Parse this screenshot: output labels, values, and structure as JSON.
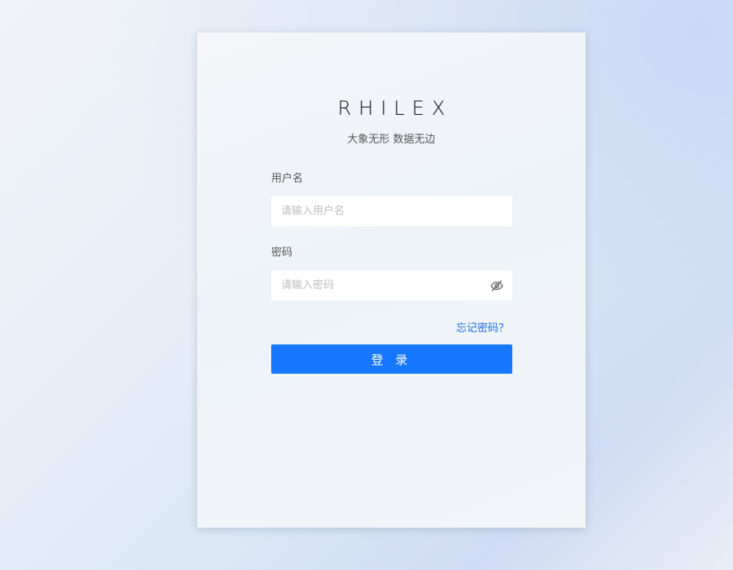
{
  "brand": {
    "logo_text": "RHILEX",
    "tagline": "大象无形 数据无边"
  },
  "form": {
    "username": {
      "label": "用户名",
      "placeholder": "请输入用户名",
      "value": ""
    },
    "password": {
      "label": "密码",
      "placeholder": "请输入密码",
      "value": "",
      "toggle_icon": "eye-invisible-icon"
    },
    "forgot_password_label": "忘记密码？",
    "submit_label": "登 录"
  },
  "colors": {
    "primary": "#1677ff",
    "link": "#1a6fd6",
    "label_text": "#555555",
    "placeholder": "#bdbdbd"
  }
}
